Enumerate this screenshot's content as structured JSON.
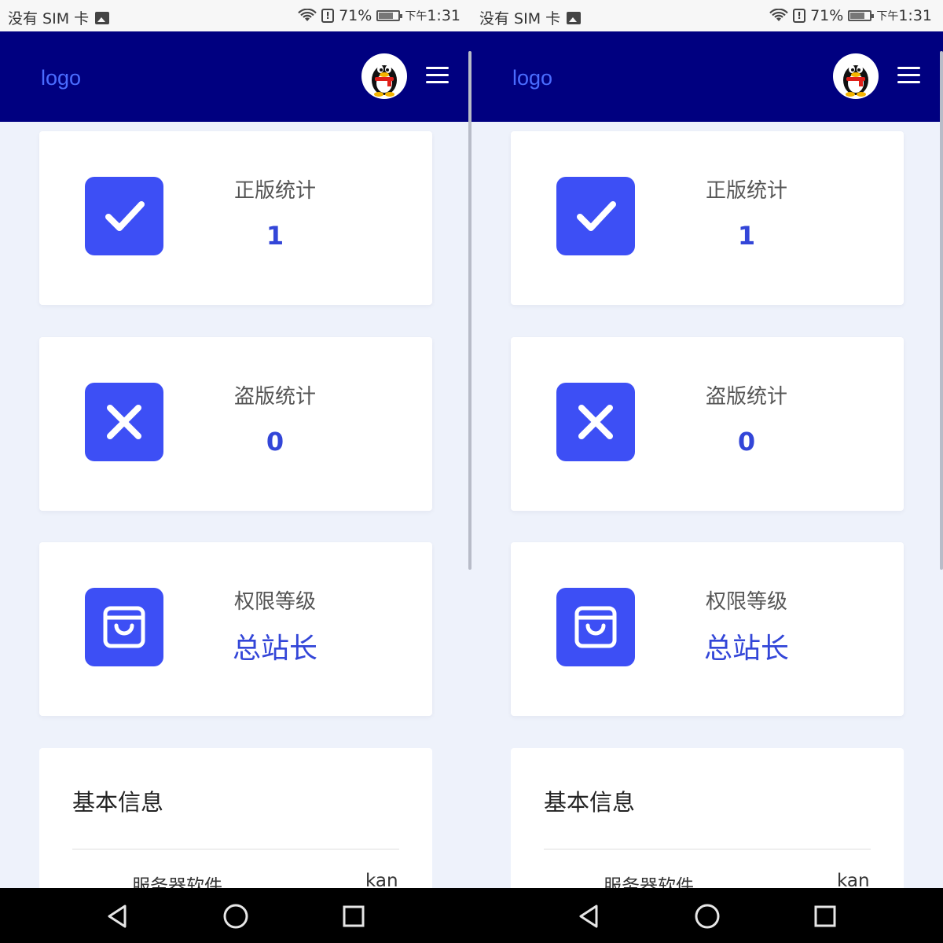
{
  "status_bar": {
    "carrier": "没有 SIM 卡",
    "battery_percent": "71%",
    "time_prefix": "下午",
    "time": "1:31"
  },
  "header": {
    "logo": "logo"
  },
  "stats": [
    {
      "label": "正版统计",
      "value": "1",
      "icon": "check-icon"
    },
    {
      "label": "盗版统计",
      "value": "0",
      "icon": "close-icon"
    },
    {
      "label": "权限等级",
      "value": "总站长",
      "icon": "shopping-bag-icon"
    }
  ],
  "info": {
    "title": "基本信息",
    "rows": [
      {
        "key": "服务器软件",
        "value": "kan"
      }
    ]
  },
  "colors": {
    "navbar": "#000080",
    "accent": "#3d4ff5",
    "value_text": "#3346d8",
    "logo": "#4a6cff",
    "background": "#eef2fb"
  }
}
